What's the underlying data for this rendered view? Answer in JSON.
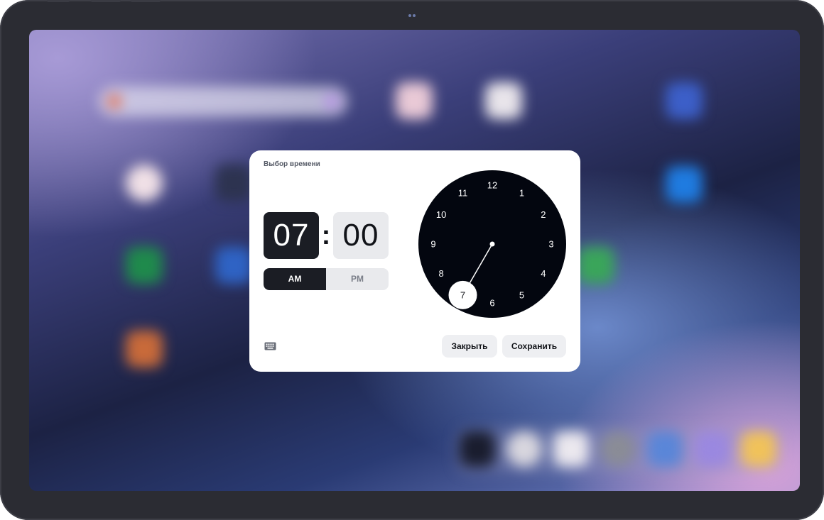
{
  "dialog": {
    "title": "Выбор времени",
    "hour": "07",
    "minute": "00",
    "separator": ":",
    "am_label": "AM",
    "pm_label": "PM",
    "selected_period": "AM",
    "close_label": "Закрыть",
    "save_label": "Сохранить",
    "keyboard_icon": "keyboard-icon"
  },
  "clock": {
    "numbers": [
      "12",
      "1",
      "2",
      "3",
      "4",
      "5",
      "6",
      "7",
      "8",
      "9",
      "10",
      "11"
    ],
    "selected_hour": 7,
    "face_color": "#03060f",
    "selection_color": "#ffffff"
  },
  "colors": {
    "dialog_bg": "#ffffff",
    "active_bg": "#1b1d24",
    "inactive_bg": "#e9eaed"
  }
}
